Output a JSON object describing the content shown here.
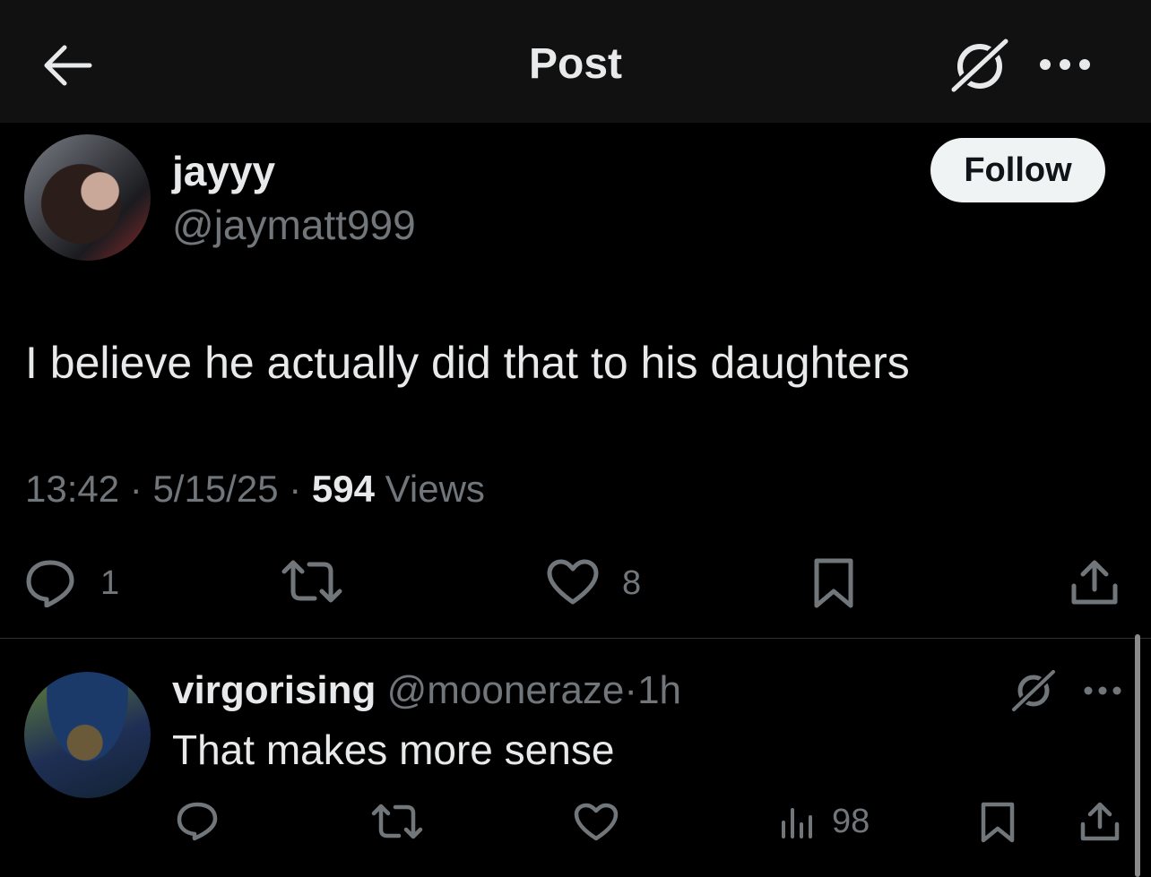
{
  "header": {
    "title": "Post",
    "back_icon": "arrow-left-icon",
    "grok_icon": "grok-icon",
    "more_icon": "more-icon"
  },
  "post": {
    "author_name": "jayyy",
    "author_handle": "@jaymatt999",
    "follow_label": "Follow",
    "text": "I believe he actually did that to his daughters",
    "time": "13:42",
    "date": "5/15/25",
    "views_count": "594",
    "views_label": "Views",
    "replies": "1",
    "likes": "8"
  },
  "reply": {
    "author_name": "virgorising",
    "author_handle": "@mooneraze",
    "dot": "·",
    "time": "1h",
    "text": "That makes more sense",
    "views": "98"
  }
}
